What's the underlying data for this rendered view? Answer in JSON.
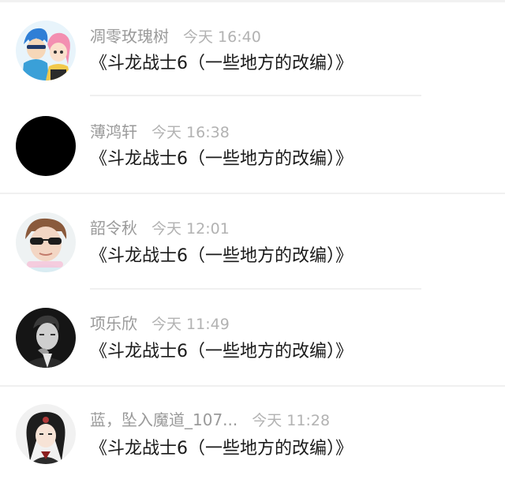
{
  "items": [
    {
      "username": "凋零玫瑰树",
      "time": "今天 16:40",
      "message": "《斗龙战士6（一些地方的改编）》",
      "avatar": "cartoon-couple-avatar"
    },
    {
      "username": "薄鸿轩",
      "time": "今天 16:38",
      "message": "《斗龙战士6（一些地方的改编）》",
      "avatar": "black-circle-avatar"
    },
    {
      "username": "韶令秋",
      "time": "今天 12:01",
      "message": "《斗龙战士6（一些地方的改编）》",
      "avatar": "sunglasses-boy-avatar"
    },
    {
      "username": "项乐欣",
      "time": "今天 11:49",
      "message": "《斗龙战士6（一些地方的改编）》",
      "avatar": "monochrome-man-avatar"
    },
    {
      "username": "蓝，坠入魔道_107...",
      "time": "今天 11:28",
      "message": "《斗龙战士6（一些地方的改编）》",
      "avatar": "anime-dark-hair-avatar"
    }
  ],
  "colors": {
    "username": "#9a9a9a",
    "time": "#b2b2b2",
    "message": "#1a1a1a",
    "divider": "#f0f0f0"
  }
}
